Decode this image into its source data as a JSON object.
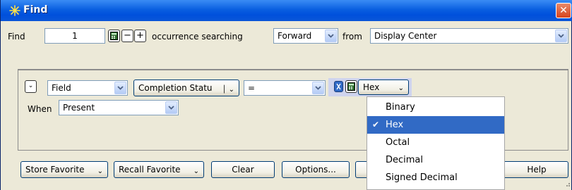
{
  "window": {
    "title": "Find",
    "close_glyph": "✕"
  },
  "find_row": {
    "find_label": "Find",
    "occurrence_value": "1",
    "plus_label": "+",
    "minus_label": "−",
    "occurrence_text": "occurrence searching",
    "direction_value": "Forward",
    "from_label": "from",
    "from_value": "Display Center"
  },
  "criteria": {
    "field_value": "Field",
    "completion_value": "Completion Statu",
    "operator_value": "=",
    "format_value": "Hex",
    "when_label": "When",
    "when_value": "Present"
  },
  "buttons": {
    "store_favorite": "Store Favorite",
    "recall_favorite": "Recall Favorite",
    "clear": "Clear",
    "options": "Options...",
    "help": "Help"
  },
  "format_menu": {
    "selected": "Hex",
    "items": [
      "Binary",
      "Hex",
      "Octal",
      "Decimal",
      "Signed Decimal"
    ]
  },
  "icons": {
    "title": "sparkle-icon",
    "calculator": "calculator-icon",
    "expand": "double-chevron-icon",
    "checkmark": "check-icon"
  },
  "colors": {
    "titlebar": "#0a5fe0",
    "selection": "#316ac5",
    "close": "#d8431c",
    "window_bg": "#ece9d8"
  }
}
